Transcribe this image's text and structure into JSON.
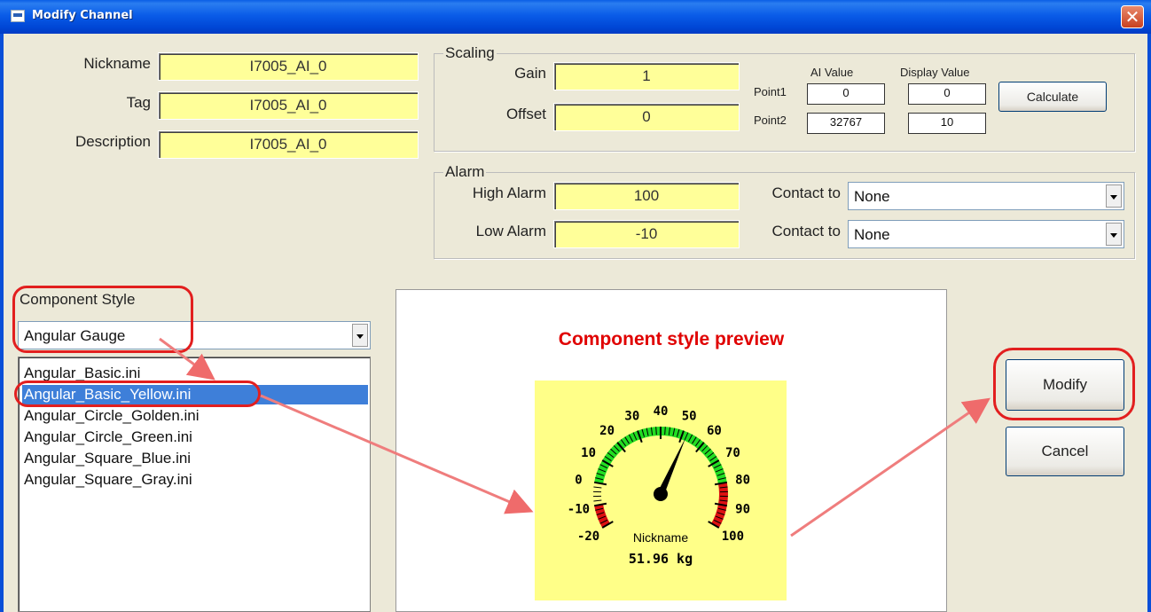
{
  "window": {
    "title": "Modify Channel",
    "close_glyph": "✕"
  },
  "identity": {
    "nickname": {
      "label": "Nickname",
      "value": "I7005_AI_0"
    },
    "tag": {
      "label": "Tag",
      "value": "I7005_AI_0"
    },
    "description": {
      "label": "Description",
      "value": "I7005_AI_0"
    }
  },
  "scaling": {
    "legend": "Scaling",
    "gain": {
      "label": "Gain",
      "value": "1"
    },
    "offset": {
      "label": "Offset",
      "value": "0"
    },
    "ai_value_header": "AI Value",
    "display_value_header": "Display Value",
    "point1": {
      "label": "Point1",
      "ai": "0",
      "display": "0"
    },
    "point2": {
      "label": "Point2",
      "ai": "32767",
      "display": "10"
    },
    "calculate_label": "Calculate"
  },
  "alarm": {
    "legend": "Alarm",
    "high": {
      "label": "High Alarm",
      "value": "100",
      "contact_label": "Contact to",
      "contact_value": "None"
    },
    "low": {
      "label": "Low Alarm",
      "value": "-10",
      "contact_label": "Contact to",
      "contact_value": "None"
    }
  },
  "component_style": {
    "label": "Component Style",
    "selected": "Angular Gauge",
    "files": [
      "Angular_Basic.ini",
      "Angular_Basic_Yellow.ini",
      "Angular_Circle_Golden.ini",
      "Angular_Circle_Green.ini",
      "Angular_Square_Blue.ini",
      "Angular_Square_Gray.ini"
    ],
    "selected_index": 1
  },
  "preview": {
    "title": "Component style preview",
    "gauge": {
      "min": -20,
      "max": 100,
      "ticks": [
        "-20",
        "-10",
        "0",
        "10",
        "20",
        "30",
        "40",
        "50",
        "60",
        "70",
        "80",
        "90",
        "100"
      ],
      "needle_value": 51.96,
      "label": "Nickname",
      "reading": "51.96 kg",
      "green_range": [
        0,
        80
      ],
      "red_ranges": [
        [
          -20,
          -10
        ],
        [
          80,
          100
        ]
      ],
      "colors": {
        "face": "#ffff88",
        "green": "#22dd22",
        "red": "#dd1111",
        "needle": "#000000"
      }
    }
  },
  "buttons": {
    "modify_label": "Modify",
    "cancel_label": "Cancel"
  },
  "colors": {
    "input_bg": "#ffff99",
    "annotation": "#e21f1f",
    "selection": "#3e7fd9",
    "preview_title": "#e00000"
  }
}
